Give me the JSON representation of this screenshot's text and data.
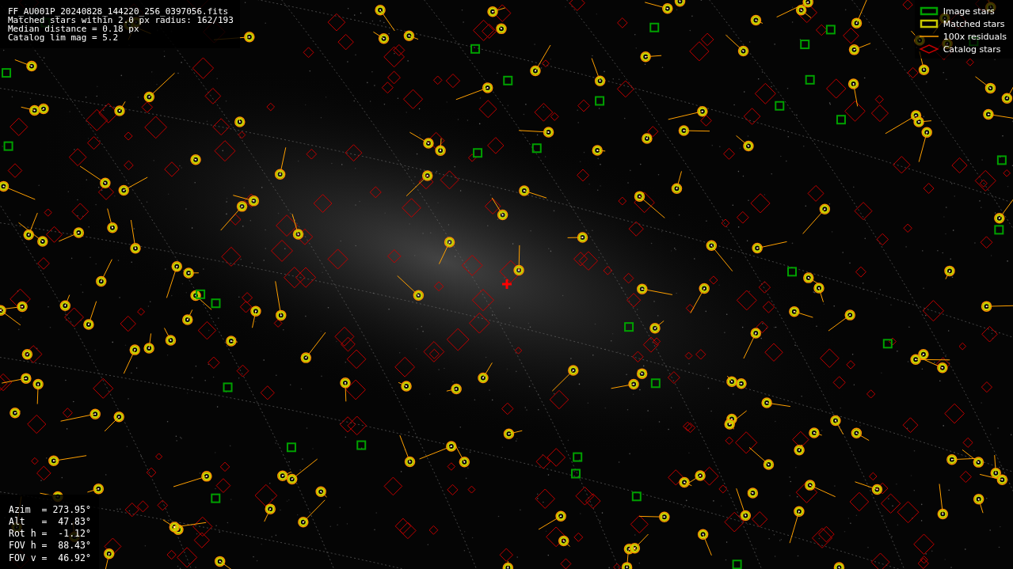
{
  "info": [
    "FF_AU001P_20240828_144220_256_0397056.fits",
    "Matched stars within 2.0 px radius: 162/193",
    "Median distance = 0.18 px",
    "Catalog lim mag = 5.2"
  ],
  "legend": [
    {
      "kind": "image",
      "label": "Image stars"
    },
    {
      "kind": "matched",
      "label": "Matched stars"
    },
    {
      "kind": "residual",
      "label": "100x residuals"
    },
    {
      "kind": "catalog",
      "label": "Catalog stars"
    }
  ],
  "pointing": [
    "Azim  = 273.95°",
    "Alt   =  47.83°",
    "Rot h =  -1.12°",
    "FOV h =  88.43°",
    "FOV v =  46.92°"
  ]
}
